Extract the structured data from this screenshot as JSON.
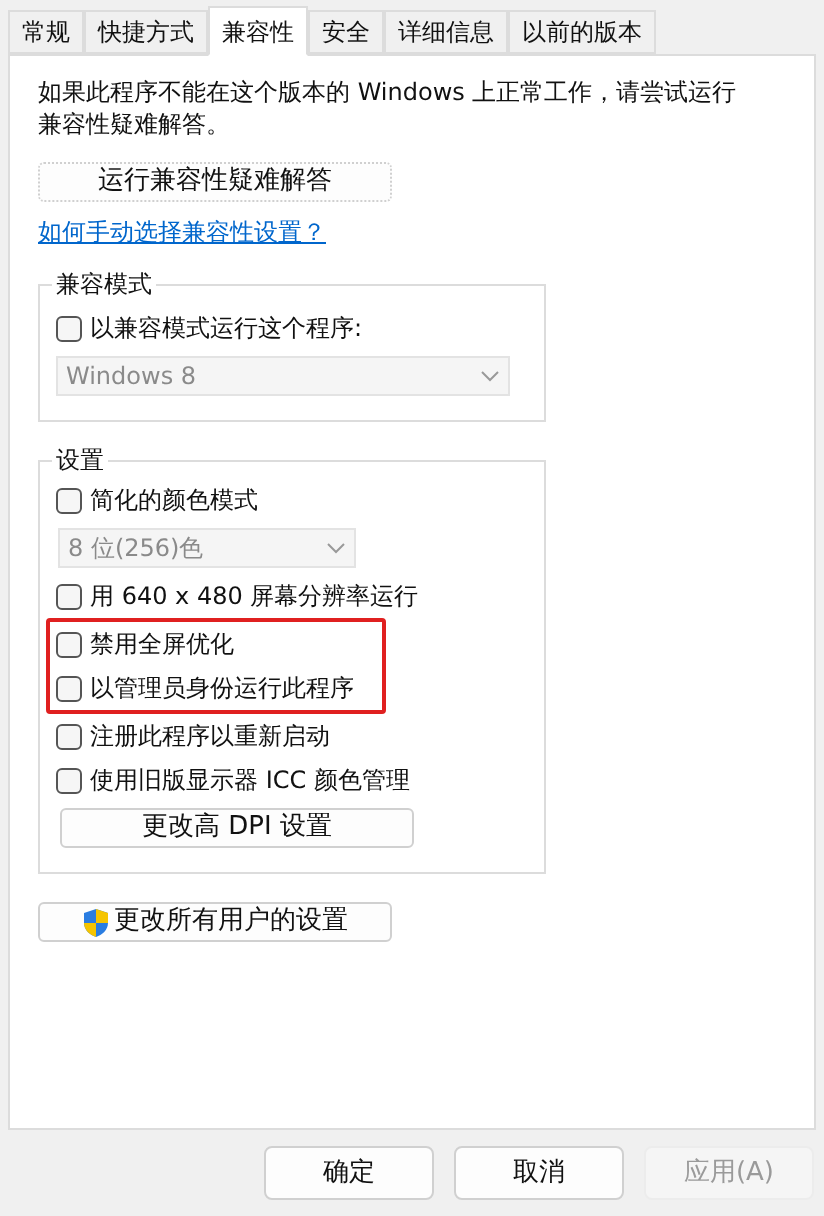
{
  "tabs": [
    {
      "label": "常规",
      "selected": false
    },
    {
      "label": "快捷方式",
      "selected": false
    },
    {
      "label": "兼容性",
      "selected": true
    },
    {
      "label": "安全",
      "selected": false
    },
    {
      "label": "详细信息",
      "selected": false
    },
    {
      "label": "以前的版本",
      "selected": false
    }
  ],
  "intro": "如果此程序不能在这个版本的 Windows 上正常工作，请尝试运行兼容性疑难解答。",
  "troubleshoot_button": "运行兼容性疑难解答",
  "help_link": "如何手动选择兼容性设置？",
  "compat_mode": {
    "title": "兼容模式",
    "checkbox": {
      "label": "以兼容模式运行这个程序:",
      "checked": false
    },
    "dropdown": {
      "value": "Windows 8",
      "disabled": true
    }
  },
  "settings": {
    "title": "设置",
    "items": [
      {
        "kind": "checkbox",
        "label": "简化的颜色模式",
        "checked": false,
        "highlighted": false
      },
      {
        "kind": "dropdown",
        "value": "8 位(256)色",
        "disabled": true,
        "highlighted": false
      },
      {
        "kind": "checkbox",
        "label": "用 640 x 480 屏幕分辨率运行",
        "checked": false,
        "highlighted": false
      },
      {
        "kind": "checkbox",
        "label": "禁用全屏优化",
        "checked": false,
        "highlighted": true
      },
      {
        "kind": "checkbox",
        "label": "以管理员身份运行此程序",
        "checked": false,
        "highlighted": true
      },
      {
        "kind": "checkbox",
        "label": "注册此程序以重新启动",
        "checked": false,
        "highlighted": false
      },
      {
        "kind": "checkbox",
        "label": "使用旧版显示器 ICC 颜色管理",
        "checked": false,
        "highlighted": false
      },
      {
        "kind": "button",
        "label": "更改高 DPI 设置",
        "highlighted": false
      }
    ]
  },
  "all_users_button": "更改所有用户的设置",
  "footer_buttons": [
    {
      "label": "确定",
      "disabled": false
    },
    {
      "label": "取消",
      "disabled": false
    },
    {
      "label": "应用(A)",
      "disabled": true
    }
  ]
}
